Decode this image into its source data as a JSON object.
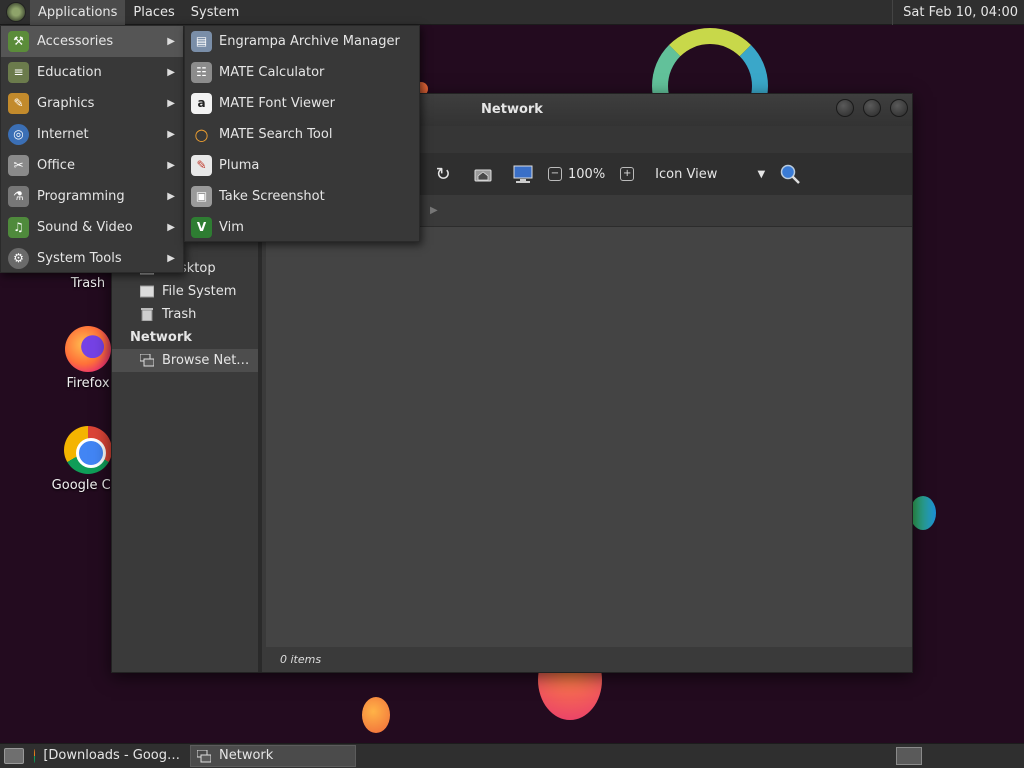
{
  "top_panel": {
    "menus": [
      "Applications",
      "Places",
      "System"
    ],
    "clock": "Sat Feb 10, 04:00"
  },
  "desktop": {
    "icons": [
      {
        "label": "Trash",
        "icon": "trash-icon"
      },
      {
        "label": "Firefox",
        "icon": "firefox-icon"
      },
      {
        "label": "Google Chr",
        "icon": "chrome-icon"
      }
    ]
  },
  "app_menu": {
    "categories": [
      {
        "label": "Accessories",
        "icon": "accessories-icon",
        "highlighted": true
      },
      {
        "label": "Education",
        "icon": "education-icon"
      },
      {
        "label": "Graphics",
        "icon": "graphics-icon"
      },
      {
        "label": "Internet",
        "icon": "internet-icon"
      },
      {
        "label": "Office",
        "icon": "office-icon"
      },
      {
        "label": "Programming",
        "icon": "programming-icon"
      },
      {
        "label": "Sound & Video",
        "icon": "sound-video-icon"
      },
      {
        "label": "System Tools",
        "icon": "system-tools-icon"
      }
    ],
    "submenu": [
      {
        "label": "Engrampa Archive Manager",
        "icon": "archive-manager-icon"
      },
      {
        "label": "MATE Calculator",
        "icon": "calculator-icon"
      },
      {
        "label": "MATE Font Viewer",
        "icon": "font-viewer-icon"
      },
      {
        "label": "MATE Search Tool",
        "icon": "search-tool-icon"
      },
      {
        "label": "Pluma",
        "icon": "text-editor-icon"
      },
      {
        "label": "Take Screenshot",
        "icon": "screenshot-icon"
      },
      {
        "label": "Vim",
        "icon": "vim-icon"
      }
    ]
  },
  "window": {
    "title": "Network",
    "toolbar": {
      "zoom": "100%",
      "view_mode": "Icon View"
    },
    "sidebar": {
      "items": [
        {
          "label": "Desktop",
          "icon": "desktop-folder-icon"
        },
        {
          "label": "File System",
          "icon": "drive-icon"
        },
        {
          "label": "Trash",
          "icon": "trash-icon"
        }
      ],
      "network_heading": "Network",
      "network_items": [
        {
          "label": "Browse Net…",
          "icon": "network-icon",
          "selected": true
        }
      ]
    },
    "status": "0 items"
  },
  "taskbar": {
    "tasks": [
      {
        "label": "[Downloads - Goog…",
        "icon": "chrome-icon",
        "active": false
      },
      {
        "label": "Network",
        "icon": "network-icon",
        "active": true
      }
    ]
  },
  "colors": {
    "desktop_bg": "#230b1f",
    "panel_bg": "#2f2f2f",
    "menu_bg": "#383838",
    "menu_highlight": "#555555"
  }
}
